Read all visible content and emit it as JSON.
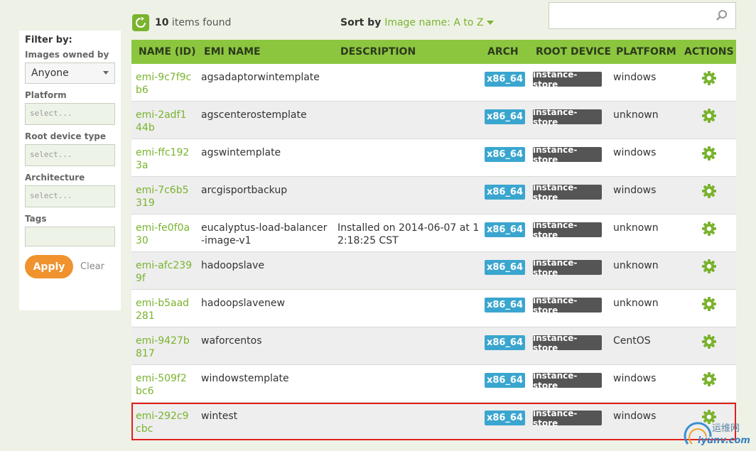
{
  "filter": {
    "title": "Filter by:",
    "owned_by_label": "Images owned by",
    "owned_by_value": "Anyone",
    "platform_label": "Platform",
    "platform_placeholder": "select...",
    "root_device_label": "Root device type",
    "root_device_placeholder": "select...",
    "architecture_label": "Architecture",
    "architecture_placeholder": "select...",
    "tags_label": "Tags",
    "tags_value": "",
    "apply_label": "Apply",
    "clear_label": "Clear"
  },
  "toolbar": {
    "count": "10",
    "count_suffix": " items found",
    "sort_label": "Sort by ",
    "sort_value": "Image name: A to Z",
    "search_value": ""
  },
  "table": {
    "headers": {
      "id": "NAME (ID)",
      "name": "EMI NAME",
      "desc": "DESCRIPTION",
      "arch": "ARCH",
      "root": "ROOT DEVICE",
      "platform": "PLATFORM",
      "actions": "ACTIONS"
    },
    "rows": [
      {
        "id": "emi-9c7f9cb6",
        "name": "agsadaptorwintemplate",
        "desc": "",
        "arch": "x86_64",
        "root": "instance-store",
        "platform": "windows"
      },
      {
        "id": "emi-2adf144b",
        "name": "agscenterostemplate",
        "desc": "",
        "arch": "x86_64",
        "root": "instance-store",
        "platform": "unknown"
      },
      {
        "id": "emi-ffc1923a",
        "name": "agswintemplate",
        "desc": "",
        "arch": "x86_64",
        "root": "instance-store",
        "platform": "windows"
      },
      {
        "id": "emi-7c6b5319",
        "name": "arcgisportbackup",
        "desc": "",
        "arch": "x86_64",
        "root": "instance-store",
        "platform": "windows"
      },
      {
        "id": "emi-fe0f0a30",
        "name": "eucalyptus-load-balancer-image-v1",
        "desc": "Installed on 2014-06-07 at 12:18:25 CST",
        "arch": "x86_64",
        "root": "instance-store",
        "platform": "unknown"
      },
      {
        "id": "emi-afc2399f",
        "name": "hadoopslave",
        "desc": "",
        "arch": "x86_64",
        "root": "instance-store",
        "platform": "unknown"
      },
      {
        "id": "emi-b5aad281",
        "name": "hadoopslavenew",
        "desc": "",
        "arch": "x86_64",
        "root": "instance-store",
        "platform": "unknown"
      },
      {
        "id": "emi-9427b817",
        "name": "waforcentos",
        "desc": "",
        "arch": "x86_64",
        "root": "instance-store",
        "platform": "CentOS"
      },
      {
        "id": "emi-509f2bc6",
        "name": "windowstemplate",
        "desc": "",
        "arch": "x86_64",
        "root": "instance-store",
        "platform": "windows"
      },
      {
        "id": "emi-292c9cbc",
        "name": "wintest",
        "desc": "",
        "arch": "x86_64",
        "root": "instance-store",
        "platform": "windows"
      }
    ]
  },
  "watermark": {
    "line1": "运维网",
    "line2": "iyunv.com"
  },
  "colors": {
    "accent": "#7ab32e",
    "header": "#8cc63f",
    "apply": "#f0922d",
    "arch_badge": "#3aa6cf",
    "device_badge": "#555555",
    "highlight": "#e0201c"
  }
}
